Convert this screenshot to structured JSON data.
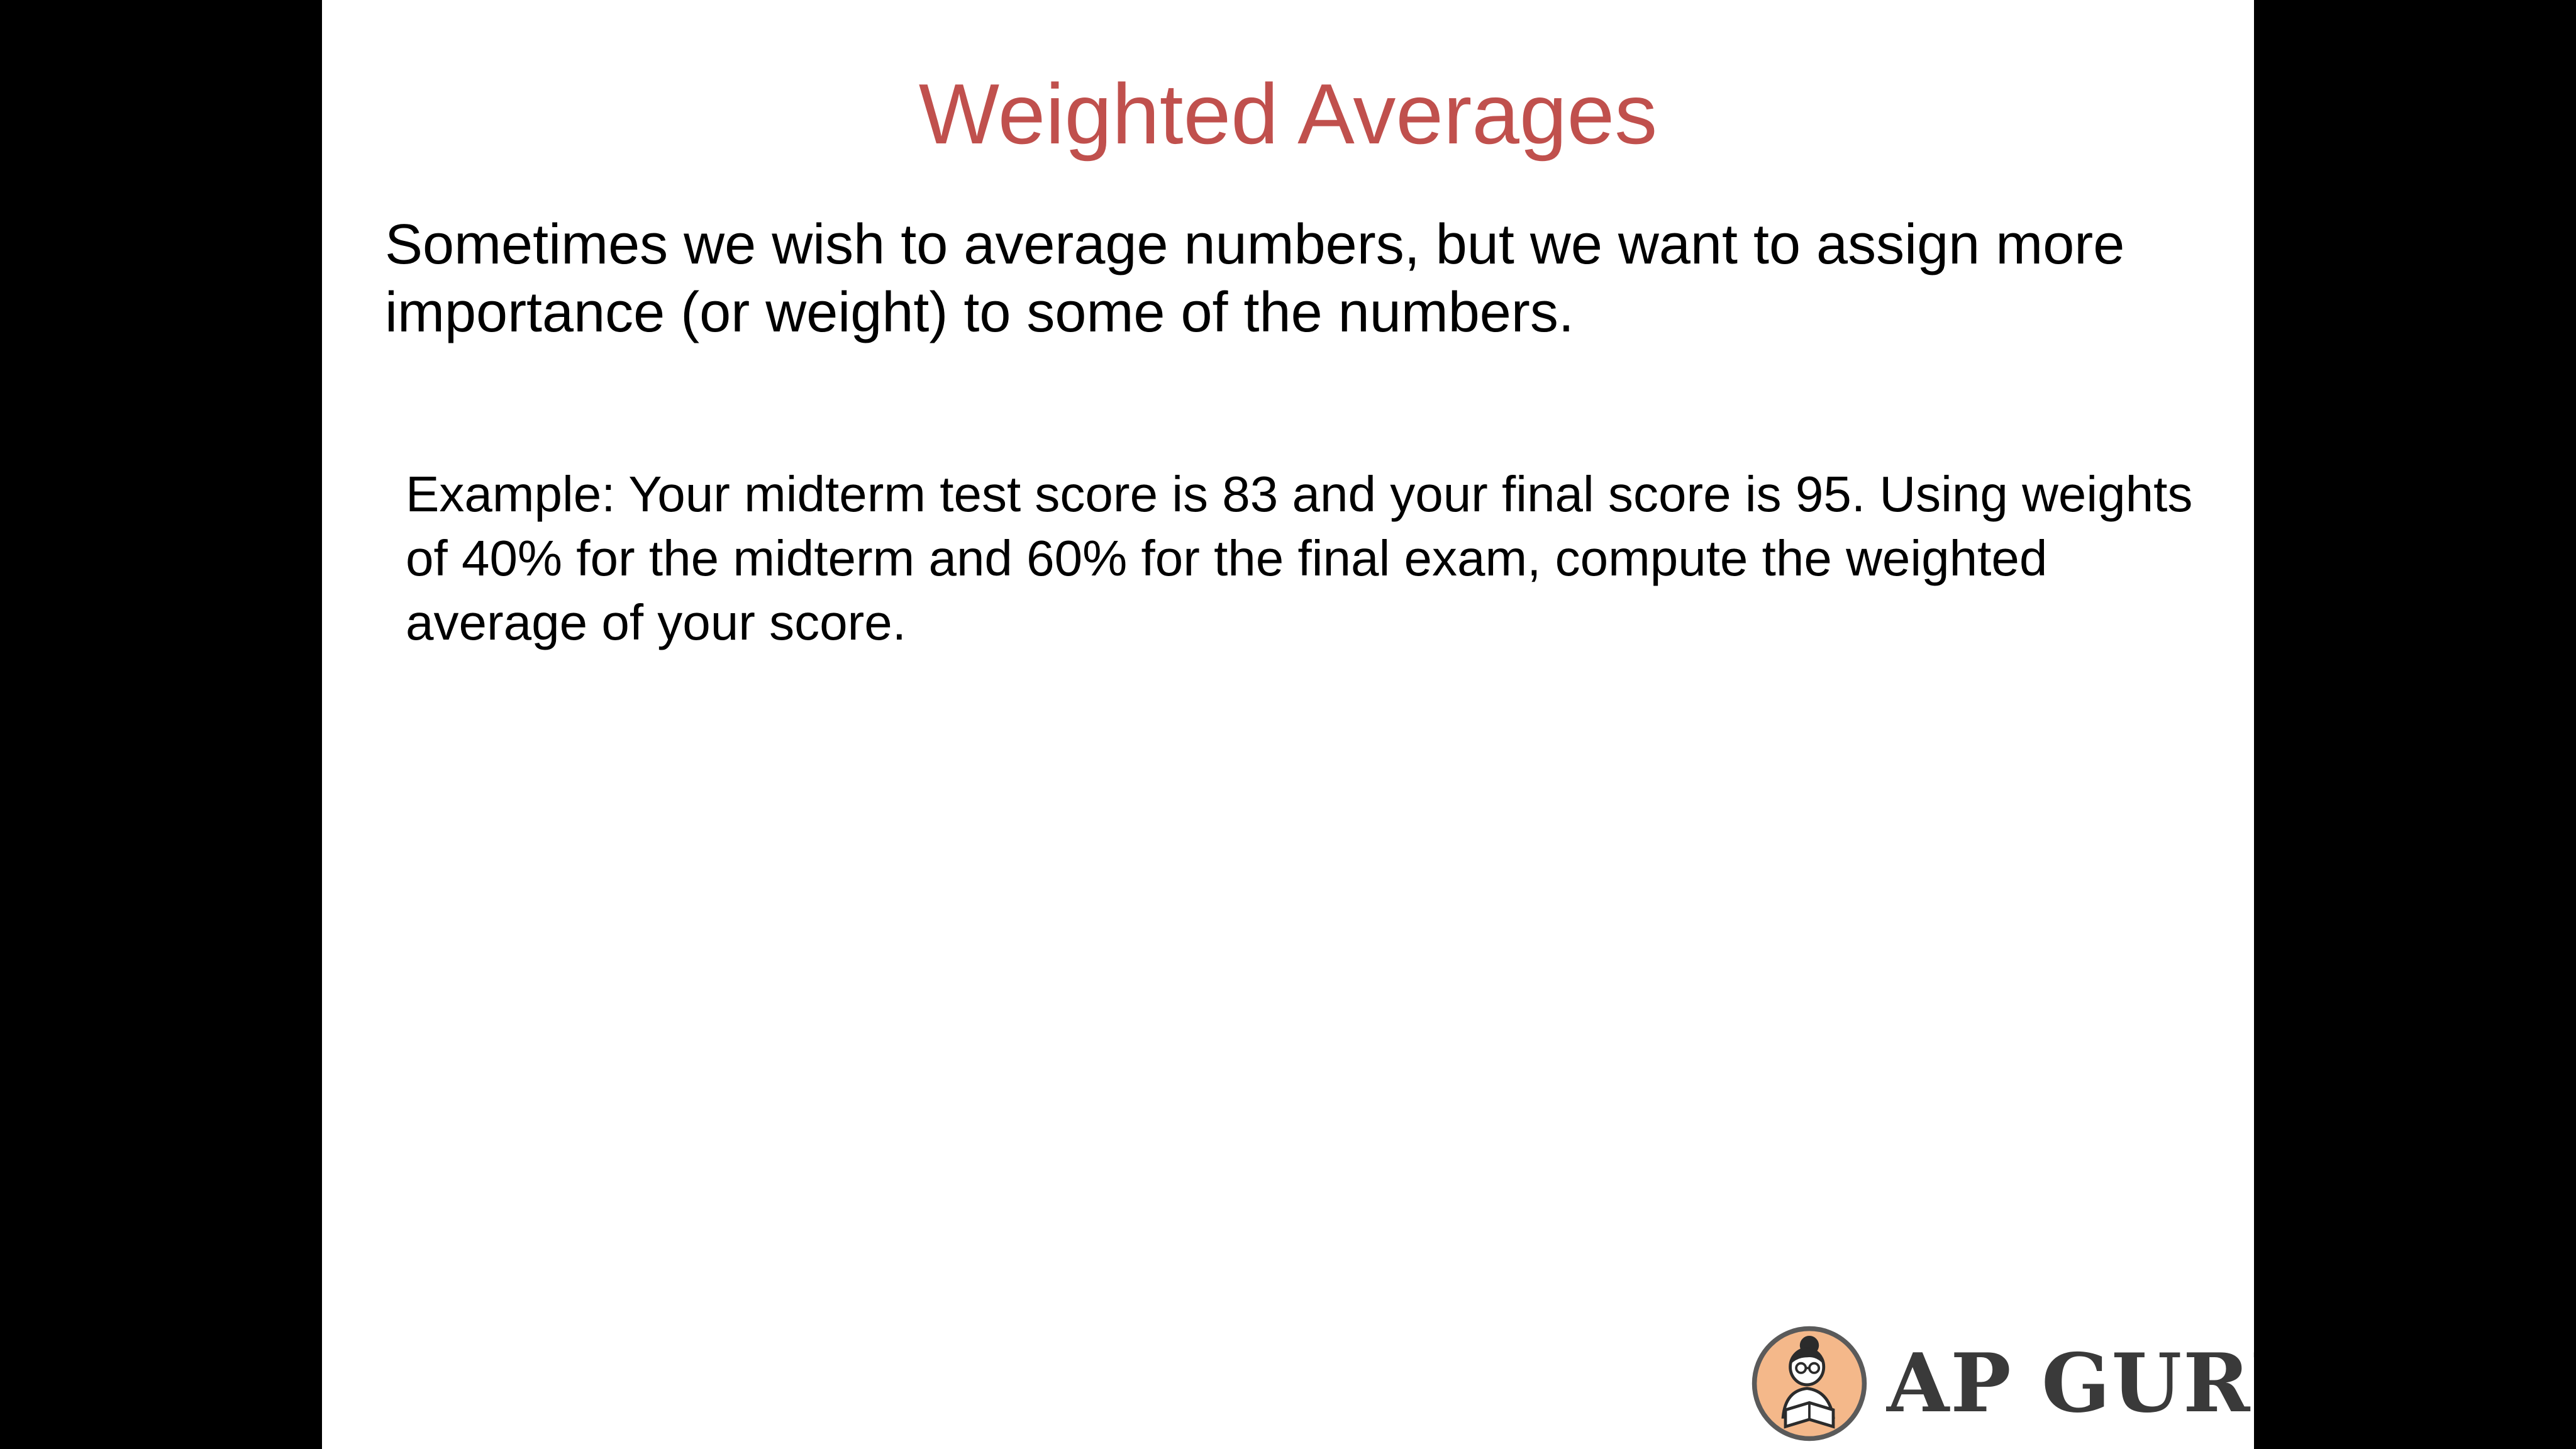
{
  "slide": {
    "title": "Weighted Averages",
    "intro": "Sometimes we wish to average numbers, but we want to assign more importance (or weight) to some of the numbers.",
    "example": "Example: Your midterm test score is 83 and your final score is 95. Using weights of 40% for the midterm and 60% for the final exam, compute the weighted average of your score."
  },
  "brand": {
    "name": "AP GURU",
    "logo_icon": "reader-avatar-icon"
  },
  "colors": {
    "title": "#c0504d",
    "background": "#ffffff",
    "letterbox": "#000000",
    "brand_text": "#3a3a3a",
    "logo_bg": "#f4b88a"
  }
}
